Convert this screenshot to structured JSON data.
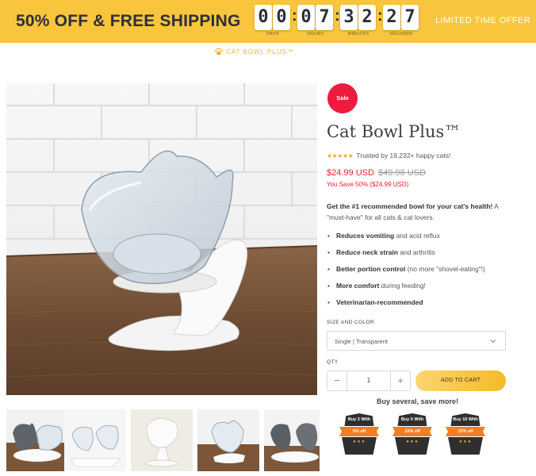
{
  "banner": {
    "headline": "50% OFF & FREE SHIPPING",
    "countdown": [
      {
        "digits": [
          "0",
          "0"
        ],
        "unit": "DAYS"
      },
      {
        "digits": [
          "0",
          "7"
        ],
        "unit": "HOURS"
      },
      {
        "digits": [
          "3",
          "2"
        ],
        "unit": "MINUTES"
      },
      {
        "digits": [
          "2",
          "7"
        ],
        "unit": "SECONDS"
      }
    ],
    "separator": ":",
    "offer": "LIMITED TIME OFFER",
    "background": "#f9c53c"
  },
  "logo": {
    "text": "CAT BOWL PLUS™",
    "icon": "paw-icon",
    "color": "#f3b530"
  },
  "product": {
    "badge": "Sale",
    "title": "Cat Bowl Plus™",
    "rating": {
      "stars": 5,
      "text": "Trusted by 19,232+ happy cats!"
    },
    "price": {
      "current": "$24.99 USD",
      "original": "$49.98 USD",
      "savings": "You Save 50% ($24.99 USD)"
    },
    "description": {
      "lead_bold": "Get the #1 recommended bowl for your cat's health!",
      "lead_rest": " A \"must-have\" for all cats & cat lovers."
    },
    "features": [
      {
        "bold": "Reduces vomiting",
        "rest": " and acid reflux"
      },
      {
        "bold": "Reduce neck strain",
        "rest": " and arthritis"
      },
      {
        "bold": "Better portion control",
        "rest": " (no more \"shovel-eating\"!)"
      },
      {
        "bold": "More comfort",
        "rest": " during feeding!"
      },
      {
        "bold": "Veterinarian-recommended",
        "rest": ""
      }
    ],
    "options": {
      "label": "SIZE AND COLOR",
      "selected": "Single | Transparent"
    },
    "quantity": {
      "label": "QTY",
      "value": "1",
      "minus": "−",
      "plus": "+"
    },
    "add_to_cart": "ADD TO CART",
    "bundles": {
      "heading": "Buy several, save more!",
      "items": [
        {
          "buy": "Buy 3 With",
          "off": "5% off"
        },
        {
          "buy": "Buy 5 With",
          "off": "10% off"
        },
        {
          "buy": "Buy 10 With",
          "off": "15% off"
        }
      ]
    }
  },
  "gallery": {
    "thumbnails": [
      {
        "variant": "double-grey-transparent"
      },
      {
        "variant": "double-transparent"
      },
      {
        "variant": "single-white"
      },
      {
        "variant": "single-transparent"
      },
      {
        "variant": "double-grey"
      }
    ]
  },
  "colors": {
    "accent": "#f9c53c",
    "sale": "#ee1b3e",
    "price": "#e8202f",
    "star": "#f5a623",
    "bundle_orange": "#f57c1f"
  }
}
